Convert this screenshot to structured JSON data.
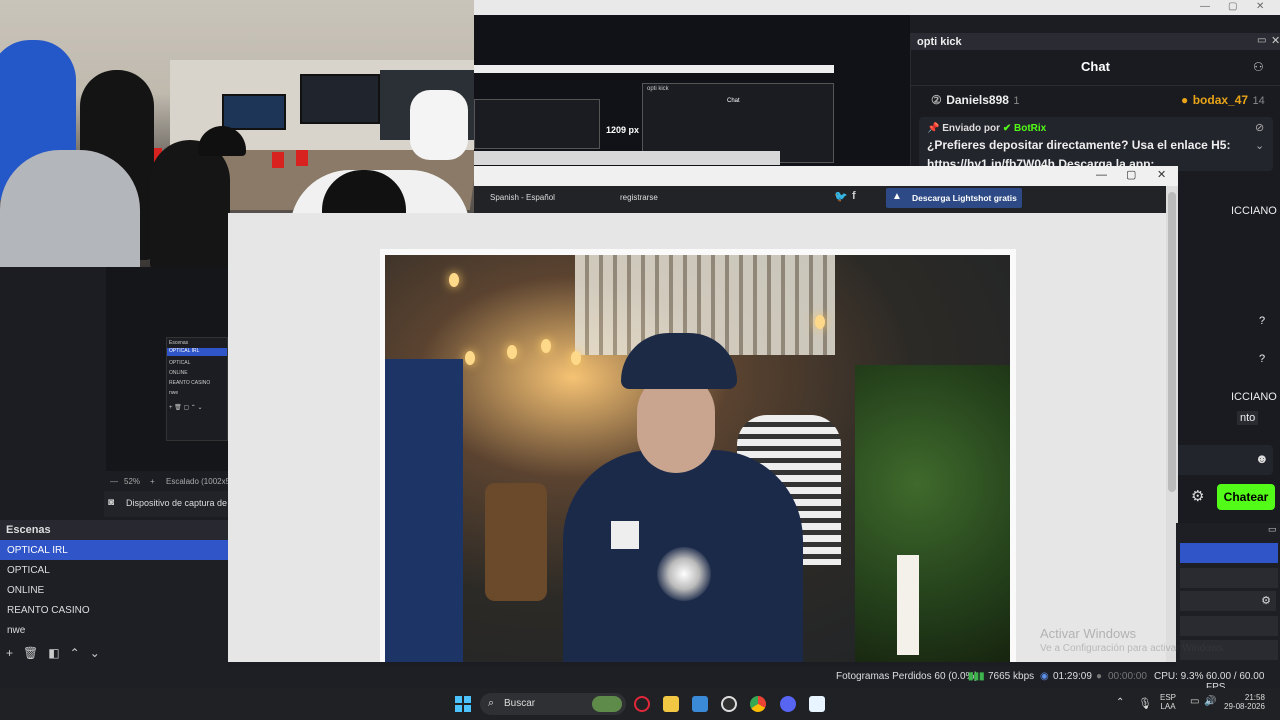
{
  "chat": {
    "panel_title": "opti kick",
    "header": "Chat",
    "user1": "Daniels898",
    "user1_badge": "1",
    "user2": "bodax_47",
    "user2_badge": "14",
    "pinned_sender_prefix": "Enviado por",
    "pinned_sender": "BotRix",
    "pinned_line1": "¿Prefieres depositar directamente? Usa el enlace H5:",
    "pinned_line2": "https://hy1.in/fb7W04h",
    "pinned_line3": "Descarga la app:",
    "snip1": "ICCIANO",
    "snip2": "?",
    "snip3": "?",
    "snip4": "ICCIANO",
    "snip5": "nto",
    "send_label": "Chatear"
  },
  "preview": {
    "zoom": "52%",
    "scale": "Escalado (1002x56",
    "source": "Dispositivo de captura de",
    "px": "1209 px"
  },
  "scenes": {
    "title": "Escenas",
    "items": [
      "OPTICAL IRL",
      "OPTICAL",
      "ONLINE",
      "REANTO CASINO",
      "nwe"
    ],
    "mini_items": [
      "Escenas",
      "OPTICAL IRL",
      "OPTICAL",
      "ONLINE",
      "REANTO CASINO",
      "nwe"
    ]
  },
  "viewer": {
    "lang": "Spanish - Español",
    "register": "registrarse",
    "download": "Descarga Lightshot gratis"
  },
  "watermark": {
    "line1": "Activar Windows",
    "line2": "Ve a Configuración para activar Windows."
  },
  "status": {
    "dropped": "Fotogramas Perdidos 60 (0.0%)",
    "kbps": "7665 kbps",
    "live": "01:29:09",
    "rec": "00:00:00",
    "cpu": "CPU: 9.3%",
    "fps": "60.00 / 60.00 FPS"
  },
  "taskbar": {
    "search": "Buscar",
    "lang1": "ESP",
    "lang2": "LAA",
    "time": "21:58",
    "date": "29-08-2026"
  },
  "colors": {
    "kick_green": "#53fc18",
    "obs_blue": "#2f55c9"
  }
}
